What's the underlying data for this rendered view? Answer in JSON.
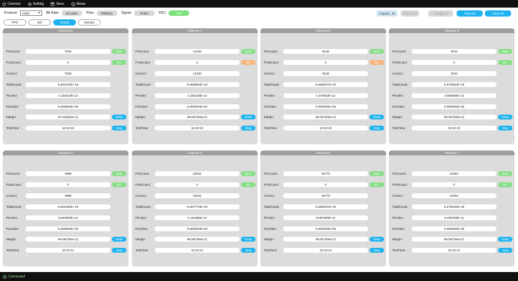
{
  "menubar": {
    "items": [
      {
        "label": "Connect",
        "icon": "link-icon"
      },
      {
        "label": "Setting",
        "icon": "gear-icon"
      },
      {
        "label": "Save",
        "icon": "save-icon"
      },
      {
        "label": "About",
        "icon": "info-icon"
      }
    ]
  },
  "toolbar": {
    "protocol_label": "Protocol:",
    "protocol_value": "CMIS",
    "bitrate_label": "Bit Rate:",
    "bitrate_value": "53.125G",
    "prbs_label": "Prbs:",
    "prbs_value": "PRBS31",
    "signal_label": "Signal:",
    "signal_value": "PAM4",
    "fec_label": "FEC:",
    "fec_value": "ON",
    "copy_label": "Copy(1...8)",
    "check_all_label": "Check All",
    "config_all_label": "Config All",
    "stop_all_label": "Stop All",
    "clear_all_label": "Clear All"
  },
  "tabs": [
    {
      "label": "PPG",
      "active": false
    },
    {
      "label": "ED",
      "active": false
    },
    {
      "label": "Result",
      "active": true
    },
    {
      "label": "Monitor",
      "active": false
    }
  ],
  "labels": {
    "precount": "PreCount:",
    "postcount": "PostCount",
    "correct": "Correct:",
    "totalcount": "TotalCount:",
    "preber": "Pre Ber:",
    "postber": "Post Ber:",
    "margin": "Margin:",
    "testtime": "TestTime:",
    "sync": "Sync",
    "err": "Err",
    "clear": "Clear",
    "stop": "Stop"
  },
  "channels": [
    {
      "name": "Channel-0",
      "precount": "7530",
      "postcount": "0",
      "correct": "7530",
      "totalcount": "5.642105E+15",
      "preber": "1.334610E-12",
      "postber": "0.000000E+00",
      "margin": "93.333(Max:1)",
      "testtime": "16:10:22",
      "err_state": "ok"
    },
    {
      "name": "Channel-1",
      "precount": "13130",
      "postcount": "0",
      "correct": "13130",
      "totalcount": "5.656890E+15",
      "preber": "2.326230E-12",
      "postber": "0.000000E+00",
      "margin": "86.667(Max:2)",
      "testtime": "16:10:22",
      "err_state": "warn"
    },
    {
      "name": "Channel-2",
      "precount": "8448",
      "postcount": "0",
      "correct": "8448",
      "totalcount": "5.656597E+15",
      "preber": "1.670620E-12",
      "postber": "0.000000E+00",
      "margin": "86.667(Max:2)",
      "testtime": "16:10:22",
      "err_state": "warn"
    },
    {
      "name": "Channel-3",
      "precount": "2034",
      "postcount": "0",
      "correct": "2034",
      "totalcount": "5.670860E+15",
      "preber": "3.585680E-13",
      "postber": "0.000000E+00",
      "margin": "86.667(Max:2)",
      "testtime": "16:10:22",
      "err_state": "ok"
    },
    {
      "name": "Channel-4",
      "precount": "4999",
      "postcount": "0",
      "correct": "4999",
      "totalcount": "5.651606E+15",
      "preber": "8.843500E-13",
      "postber": "0.000000E+00",
      "margin": "86.667(Max:2)",
      "testtime": "16:10:21",
      "err_state": "ok"
    },
    {
      "name": "Channel-5",
      "precount": "23531",
      "postcount": "0",
      "correct": "23531",
      "totalcount": "5.667770E+15",
      "preber": "4.151680E-12",
      "postber": "0.000000E+00",
      "margin": "86.667(Max:2)",
      "testtime": "16:10:21",
      "err_state": "ok"
    },
    {
      "name": "Channel-6",
      "precount": "45770",
      "postcount": "0",
      "correct": "45770",
      "totalcount": "5.659297E+15",
      "preber": "8.087590E-12",
      "postber": "0.000000E+00",
      "margin": "86.667(Max:2)",
      "testtime": "16:10:21",
      "err_state": "ok"
    },
    {
      "name": "Channel-7",
      "precount": "31084",
      "postcount": "0",
      "correct": "31084",
      "totalcount": "5.678645E+15",
      "preber": "5.459750E-12",
      "postber": "0.000000E+00",
      "margin": "86.667(Max:2)",
      "testtime": "16:10:21",
      "err_state": "ok"
    }
  ],
  "status": {
    "text": "Connected",
    "icon": "check-circle-icon"
  },
  "colors": {
    "accent": "#1fb3f0",
    "sync": "#86df86",
    "err_warn": "#f6b57a",
    "panel_bg": "#dcdcdc",
    "panel_head": "#9e9e9e"
  }
}
